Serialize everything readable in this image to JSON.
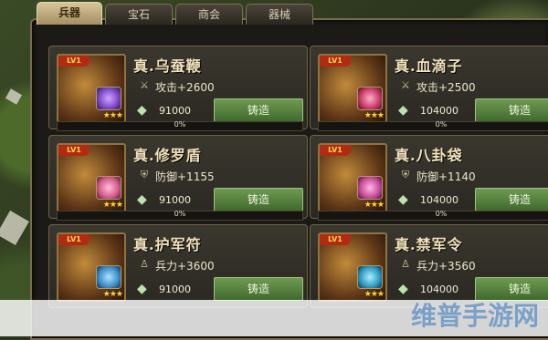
{
  "tabs": [
    {
      "label": "兵器",
      "active": true
    },
    {
      "label": "宝石",
      "active": false
    },
    {
      "label": "商会",
      "active": false
    },
    {
      "label": "器械",
      "active": false
    }
  ],
  "items": [
    {
      "level": "LV1",
      "name": "真.乌蚕鞭",
      "stat_icon": "sword-icon",
      "stat": "攻击+2600",
      "price": "91000",
      "button": "铸造",
      "progress": "0%",
      "progress_value": 0,
      "gem_color": "#7b48c8"
    },
    {
      "level": "LV1",
      "name": "真.血滴子",
      "stat_icon": "sword-icon",
      "stat": "攻击+2500",
      "price": "104000",
      "button": "铸造",
      "progress": "0%",
      "progress_value": 0,
      "gem_color": "#c83b6a"
    },
    {
      "level": "LV1",
      "name": "真.修罗盾",
      "stat_icon": "shield-icon",
      "stat": "防御+1155",
      "price": "91000",
      "button": "铸造",
      "progress": "0%",
      "progress_value": 0,
      "gem_color": "#d45a8c"
    },
    {
      "level": "LV1",
      "name": "真.八卦袋",
      "stat_icon": "shield-icon",
      "stat": "防御+1140",
      "price": "104000",
      "button": "铸造",
      "progress": "0%",
      "progress_value": 0,
      "gem_color": "#c84a9a"
    },
    {
      "level": "LV1",
      "name": "真.护军符",
      "stat_icon": "soldier-icon",
      "stat": "兵力+3600",
      "price": "91000",
      "button": "铸造",
      "progress": "",
      "progress_value": 0,
      "gem_color": "#3b8fc8"
    },
    {
      "level": "LV1",
      "name": "真.禁军令",
      "stat_icon": "soldier-icon",
      "stat": "兵力+3560",
      "price": "104000",
      "button": "铸造",
      "progress": "",
      "progress_value": 0,
      "gem_color": "#2f9ac0"
    }
  ],
  "watermark": "维普手游网"
}
